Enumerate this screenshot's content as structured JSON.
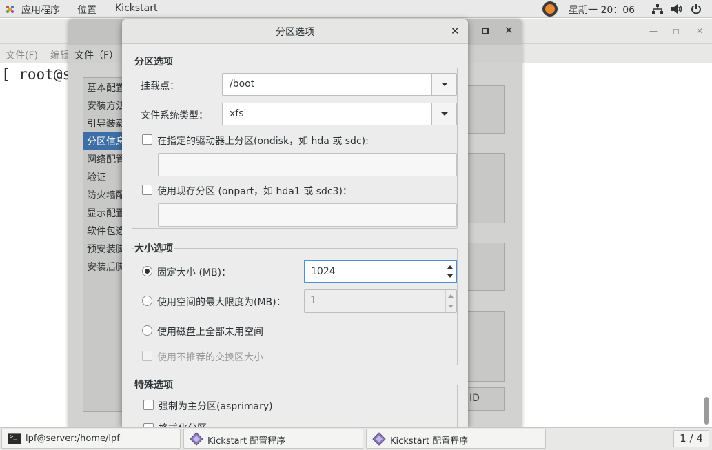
{
  "topbar": {
    "apps": "应用程序",
    "places": "位置",
    "app_name": "Kickstart",
    "clock": "星期一 20：06"
  },
  "terminal": {
    "menu_file": "文件(F)",
    "menu_edit": "编辑",
    "prompt": "[ root@se"
  },
  "kickstart": {
    "menu_file": "文件（F）",
    "sidebar": [
      "基本配置",
      "安装方法",
      "引导装载",
      "分区信息",
      "网络配置",
      "验证",
      "防火墙配",
      "显示配置",
      "软件包选",
      "预安装脚",
      "安装后脚"
    ],
    "selected_index": 3,
    "button_fragment": "ID"
  },
  "dialog": {
    "title": "分区选项",
    "section_partition": "分区选项",
    "mount_label": "挂载点：",
    "mount_value": "/boot",
    "fstype_label": "文件系统类型：",
    "fstype_value": "xfs",
    "ondisk_label": "在指定的驱动器上分区(ondisk，如 hda 或 sdc):",
    "ondisk_value": "",
    "onpart_label": "使用现存分区 (onpart，如 hda1 或 sdc3)：",
    "onpart_value": "",
    "section_size": "大小选项",
    "fixed_label": "固定大小 (MB)：",
    "fixed_value": "1024",
    "max_label": "使用空间的最大限度为(MB)：",
    "max_value": "1",
    "all_label": "使用磁盘上全部未用空间",
    "swap_label": "使用不推荐的交换区大小",
    "section_special": "特殊选项",
    "primary_label": "强制为主分区(asprimary)",
    "format_label": "格式化分区"
  },
  "taskbar": {
    "task1": "lpf@server:/home/lpf",
    "task2": "Kickstart 配置程序",
    "task3": "Kickstart 配置程序",
    "pager": "1 / 4"
  },
  "colors": {
    "accent": "#4a90d9",
    "selection": "#3d6fa6"
  }
}
